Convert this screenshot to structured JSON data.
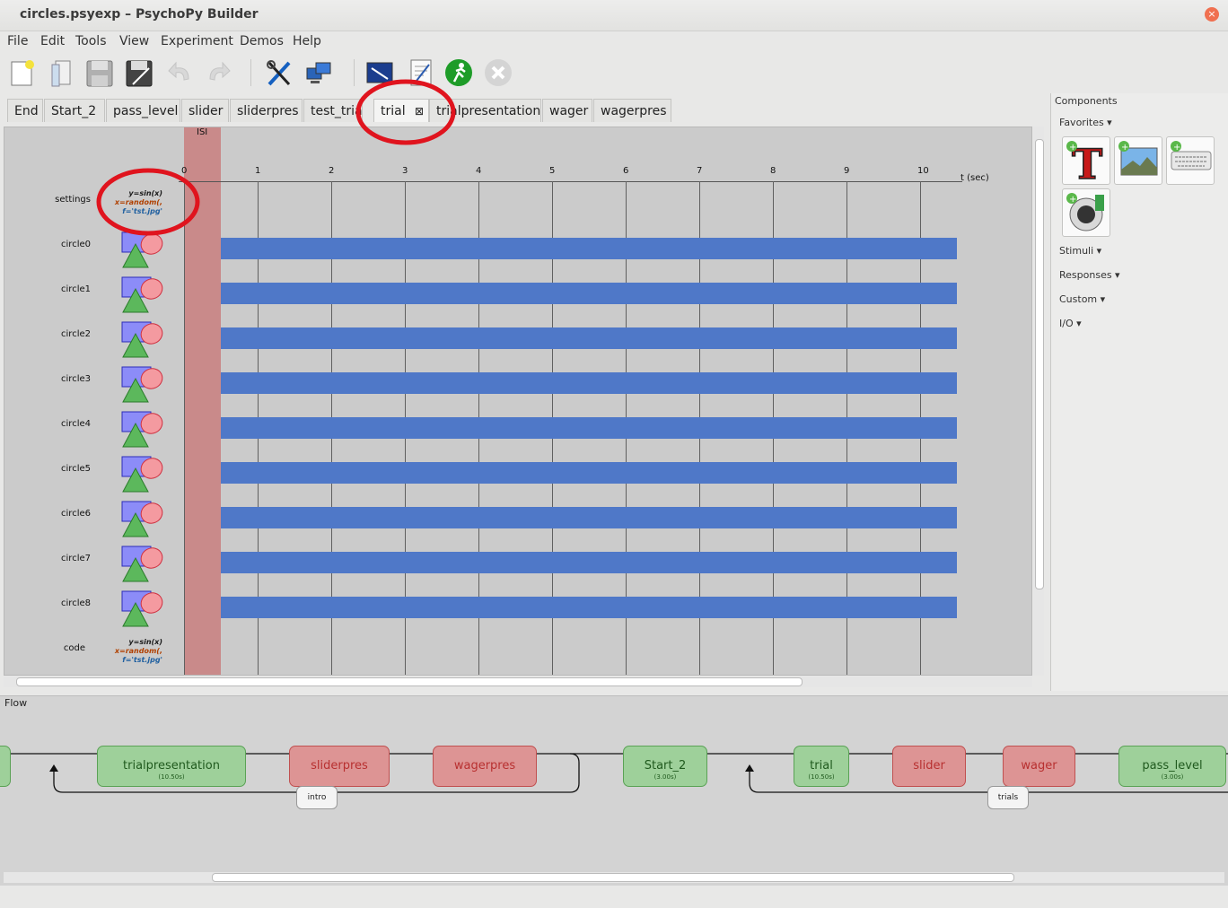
{
  "window": {
    "title": "circles.psyexp – PsychoPy Builder",
    "close_glyph": "×"
  },
  "menu": [
    "File",
    "Edit",
    "Tools",
    "View",
    "Experiment",
    "Demos",
    "Help"
  ],
  "toolbar_icons": [
    "new-file-icon",
    "open-file-icon",
    "save-icon",
    "save-as-icon",
    "undo-icon",
    "redo-icon",
    "preferences-icon",
    "monitor-center-icon",
    "experiment-settings-icon",
    "compile-script-icon",
    "run-icon",
    "stop-icon"
  ],
  "tabs": [
    {
      "label": "End"
    },
    {
      "label": "Start_2"
    },
    {
      "label": "pass_level"
    },
    {
      "label": "slider"
    },
    {
      "label": "sliderpres"
    },
    {
      "label": "test_trial"
    },
    {
      "label": "trial",
      "active": true,
      "close": "⊠"
    },
    {
      "label": "trialpresentation"
    },
    {
      "label": "wager"
    },
    {
      "label": "wagerpres"
    }
  ],
  "routine": {
    "isi_label": "ISI",
    "axis_ticks": [
      "0",
      "1",
      "2",
      "3",
      "4",
      "5",
      "6",
      "7",
      "8",
      "9",
      "10"
    ],
    "axis_label": "t (sec)",
    "settings": {
      "name": "settings",
      "code": [
        "y=sin(x)",
        "x=random(,",
        "f='tst.jpg'"
      ]
    },
    "components": [
      {
        "name": "circle0"
      },
      {
        "name": "circle1"
      },
      {
        "name": "circle2"
      },
      {
        "name": "circle3"
      },
      {
        "name": "circle4"
      },
      {
        "name": "circle5"
      },
      {
        "name": "circle6"
      },
      {
        "name": "circle7"
      },
      {
        "name": "circle8"
      }
    ],
    "code": {
      "name": "code",
      "code": [
        "y=sin(x)",
        "x=random(,",
        "f='tst.jpg'"
      ]
    },
    "bar_start_s": 0.5,
    "bar_end_s": 10.5,
    "isi_start_s": 0,
    "isi_end_s": 0.5
  },
  "components_panel": {
    "title": "Components",
    "favorites": "Favorites ▾",
    "favorite_icons": [
      "text-component-icon",
      "image-component-icon",
      "keyboard-component-icon",
      "sound-component-icon"
    ],
    "categories": [
      "Stimuli ▾",
      "Responses ▾",
      "Custom ▾",
      "I/O ▾"
    ]
  },
  "flow": {
    "title": "Flow",
    "routines": [
      {
        "label": "trialpresentation",
        "duration": "(10.50s)",
        "kind": "green"
      },
      {
        "label": "sliderpres",
        "kind": "red"
      },
      {
        "label": "wagerpres",
        "kind": "red"
      },
      {
        "label": "Start_2",
        "duration": "(3.00s)",
        "kind": "green"
      },
      {
        "label": "trial",
        "duration": "(10.50s)",
        "kind": "green"
      },
      {
        "label": "slider",
        "kind": "red"
      },
      {
        "label": "wager",
        "kind": "red"
      },
      {
        "label": "pass_level",
        "duration": "(3.00s)",
        "kind": "green"
      }
    ],
    "loops": [
      "intro",
      "trials"
    ]
  },
  "colors": {
    "bar": "#4f78c8",
    "isi": "#c98a8a",
    "annotation": "#e0141e",
    "green_routine": "#9ed09a",
    "red_routine": "#dd9494"
  }
}
